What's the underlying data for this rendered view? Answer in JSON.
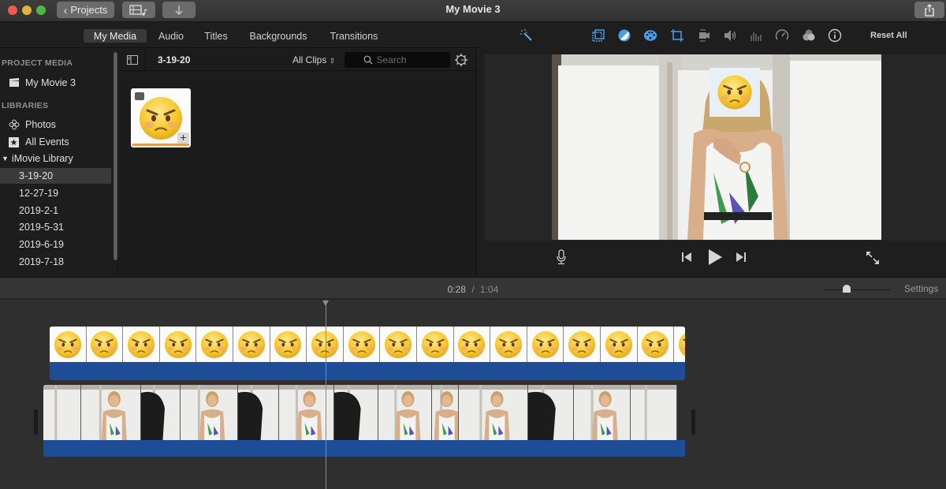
{
  "window": {
    "title": "My Movie 3",
    "projects_button": "Projects"
  },
  "browser_tabs": [
    {
      "label": "My Media",
      "active": true
    },
    {
      "label": "Audio",
      "active": false
    },
    {
      "label": "Titles",
      "active": false
    },
    {
      "label": "Backgrounds",
      "active": false
    },
    {
      "label": "Transitions",
      "active": false
    }
  ],
  "inspector": {
    "icons": [
      "magic-wand",
      "color-balance",
      "color-correction",
      "color-palette",
      "crop",
      "stabilization",
      "volume",
      "noise-reduction-equalizer",
      "speed",
      "clip-filter",
      "info"
    ],
    "reset_all": "Reset All",
    "accent": "#4a9ee8"
  },
  "sidebar": {
    "project_media_header": "PROJECT MEDIA",
    "project": "My Movie 3",
    "libraries_header": "LIBRARIES",
    "photos": "Photos",
    "all_events": "All Events",
    "library": "iMovie Library",
    "events": [
      {
        "label": "3-19-20",
        "selected": true
      },
      {
        "label": "12-27-19",
        "selected": false
      },
      {
        "label": "2019-2-1",
        "selected": false
      },
      {
        "label": "2019-5-31",
        "selected": false
      },
      {
        "label": "2019-6-19",
        "selected": false
      },
      {
        "label": "2019-7-18",
        "selected": false
      }
    ]
  },
  "browser": {
    "event_title": "3-19-20",
    "filter": "All Clips",
    "search_placeholder": "Search",
    "search_value": "",
    "clips": [
      {
        "type": "photo",
        "content": "angry-face-emoji"
      }
    ]
  },
  "viewer": {
    "overlay": "angry-face-emoji"
  },
  "timeline": {
    "current_time": "0:28",
    "separator": "/",
    "total_time": "1:04",
    "settings_label": "Settings",
    "zoom_level": 0.35,
    "overlay_clip_frames": 18,
    "audio_color": "#1f4c96"
  }
}
